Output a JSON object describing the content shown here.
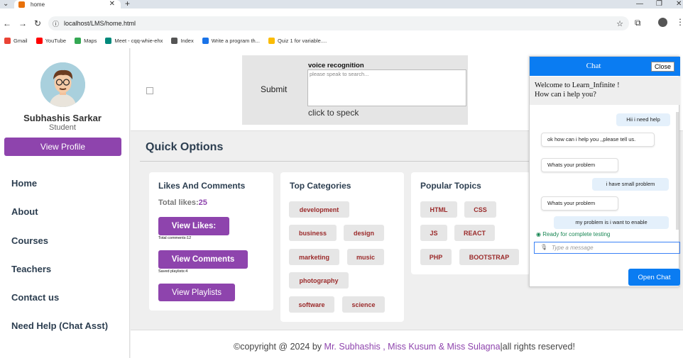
{
  "browser": {
    "tab_title": "home",
    "url": "localhost/LMS/home.html",
    "bookmarks": [
      {
        "label": "Gmail",
        "color": "#ea4335"
      },
      {
        "label": "YouTube",
        "color": "#ff0000"
      },
      {
        "label": "Maps",
        "color": "#34a853"
      },
      {
        "label": "Meet - cqq-whie-ehx",
        "color": "#00897b"
      },
      {
        "label": "Index",
        "color": "#555555"
      },
      {
        "label": "Write a program th...",
        "color": "#1a73e8"
      },
      {
        "label": "Quiz 1 for variable....",
        "color": "#fbbc04"
      }
    ]
  },
  "sidebar": {
    "name": "Subhashis Sarkar",
    "role": "Student",
    "view_profile": "View Profile",
    "nav": [
      "Home",
      "About",
      "Courses",
      "Teachers",
      "Contact us",
      "Need Help (Chat Asst)"
    ]
  },
  "voice": {
    "submit": "Submit",
    "title": "voice recognition",
    "placeholder": "please speak to search...",
    "click": "click to speck"
  },
  "main": {
    "title": "Quick Options",
    "likes": {
      "title": "Likes And Comments",
      "total_likes_label": "Total likes:",
      "total_likes_value": "25",
      "view_likes": "View Likes:",
      "total_comments": "Total comments:12",
      "view_comments": "View Comments",
      "saved_playlists": "Saved playlists:4",
      "view_playlists": "View Playlists"
    },
    "categories": {
      "title": "Top Categories",
      "items": [
        "development",
        "business",
        "design",
        "marketing",
        "music",
        "photography",
        "software",
        "science"
      ]
    },
    "topics": {
      "title": "Popular Topics",
      "items": [
        "HTML",
        "CSS",
        "JS",
        "REACT",
        "PHP",
        "BOOTSTRAP"
      ]
    }
  },
  "footer": {
    "prefix": "©copyright @ 2024 by ",
    "authors": "Mr. Subhashis , Miss Kusum & Miss Sulagna",
    "suffix": "|all rights reserved!"
  },
  "chat": {
    "title": "Chat",
    "close": "Close",
    "welcome_1": "Welcome to Learn_Infinite !",
    "welcome_2": "How can i help you?",
    "messages": [
      {
        "from": "user",
        "text": "Hii i need help"
      },
      {
        "from": "bot",
        "text": "ok how can i help you ,,please tell us."
      },
      {
        "from": "bot",
        "text": "Whats your problem"
      },
      {
        "from": "user",
        "text": "i have small problem"
      },
      {
        "from": "bot",
        "text": "Whats your problem"
      },
      {
        "from": "user",
        "text": "my problem is i want to enable"
      }
    ],
    "status": "Ready for complete testing",
    "input_placeholder": "Type a message",
    "open_chat": "Open Chat"
  }
}
